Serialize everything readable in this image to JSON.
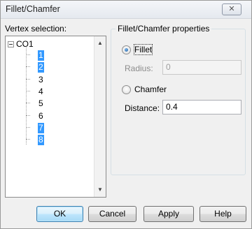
{
  "window": {
    "title": "Fillet/Chamfer",
    "close_symbol": "✕"
  },
  "vertex_selection": {
    "label": "Vertex selection:",
    "tree": {
      "root_label": "CO1",
      "items": [
        {
          "label": "1",
          "selected": true
        },
        {
          "label": "2",
          "selected": true
        },
        {
          "label": "3",
          "selected": false
        },
        {
          "label": "4",
          "selected": false
        },
        {
          "label": "5",
          "selected": false
        },
        {
          "label": "6",
          "selected": false
        },
        {
          "label": "7",
          "selected": true
        },
        {
          "label": "8",
          "selected": true
        }
      ]
    },
    "scroll_up": "▲",
    "scroll_down": "▼"
  },
  "properties": {
    "group_title": "Fillet/Chamfer properties",
    "fillet_label": "Fillet",
    "fillet_checked": true,
    "radius_label": "Radius:",
    "radius_value": "0",
    "chamfer_label": "Chamfer",
    "chamfer_checked": false,
    "distance_label": "Distance:",
    "distance_value": "0.4"
  },
  "buttons": {
    "ok": "OK",
    "cancel": "Cancel",
    "apply": "Apply",
    "help": "Help"
  },
  "colors": {
    "selection": "#3399ff",
    "dialog_bg": "#f0f0f0"
  }
}
